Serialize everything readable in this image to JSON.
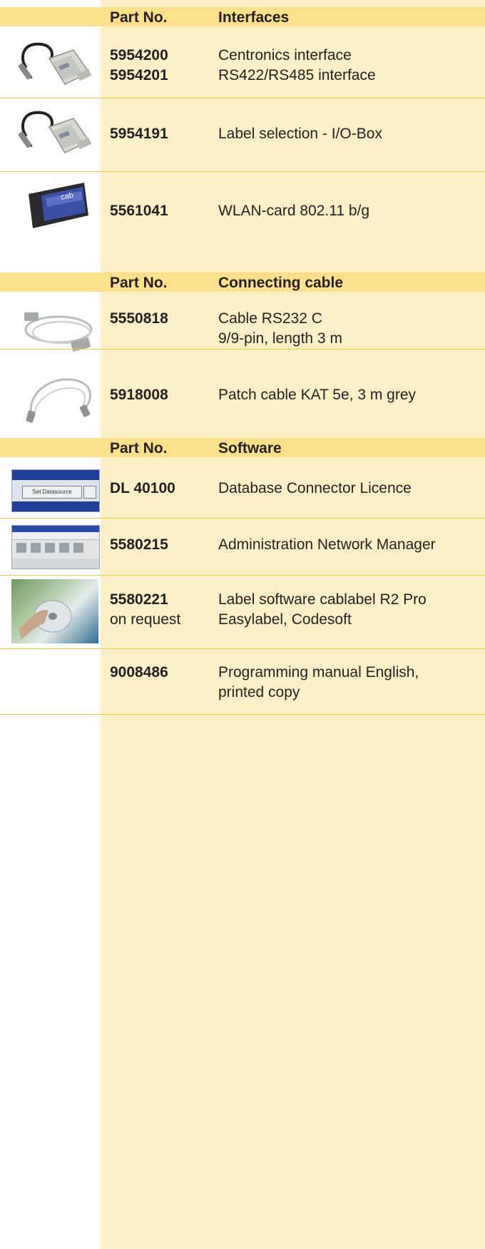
{
  "sections": [
    {
      "col1": "Part No.",
      "col2": "Interfaces",
      "rows": [
        {
          "part": [
            "5954200",
            "5954201"
          ],
          "desc": [
            "Centronics interface",
            "RS422/RS485 interface"
          ],
          "icon": "interface-adapter-cable-icon"
        },
        {
          "part": [
            "5954191"
          ],
          "desc": [
            "Label selection - I/O-Box"
          ],
          "icon": "io-box-cable-icon"
        },
        {
          "part": [
            "5561041"
          ],
          "desc": [
            "WLAN-card 802.11 b/g"
          ],
          "icon": "wlan-card-icon",
          "card_label": "cab"
        }
      ]
    },
    {
      "col1": "Part No.",
      "col2": "Connecting cable",
      "rows": [
        {
          "part": [
            "5550818"
          ],
          "desc": [
            "Cable RS232 C",
            "9/9-pin, length 3 m"
          ],
          "icon": "serial-cable-icon"
        },
        {
          "part": [
            "5918008"
          ],
          "desc": [
            "Patch cable KAT 5e, 3 m grey"
          ],
          "icon": "patch-cable-icon"
        }
      ]
    },
    {
      "col1": "Part No.",
      "col2": "Software",
      "rows": [
        {
          "part": [
            "DL 40100"
          ],
          "desc": [
            "Database Connector Licence"
          ],
          "icon": "database-connector-screenshot",
          "button_label": "Set Datasource"
        },
        {
          "part": [
            "5580215"
          ],
          "desc": [
            "Administration Network Manager"
          ],
          "icon": "network-manager-screenshot"
        },
        {
          "part": [
            "5580221"
          ],
          "part_note": "on request",
          "desc": [
            "Label software cablabel R2 Pro",
            "Easylabel, Codesoft"
          ],
          "icon": "software-cd-icon"
        },
        {
          "part": [
            "9008486"
          ],
          "desc": [
            "Programming manual English,",
            "printed copy"
          ],
          "icon": ""
        }
      ]
    }
  ]
}
